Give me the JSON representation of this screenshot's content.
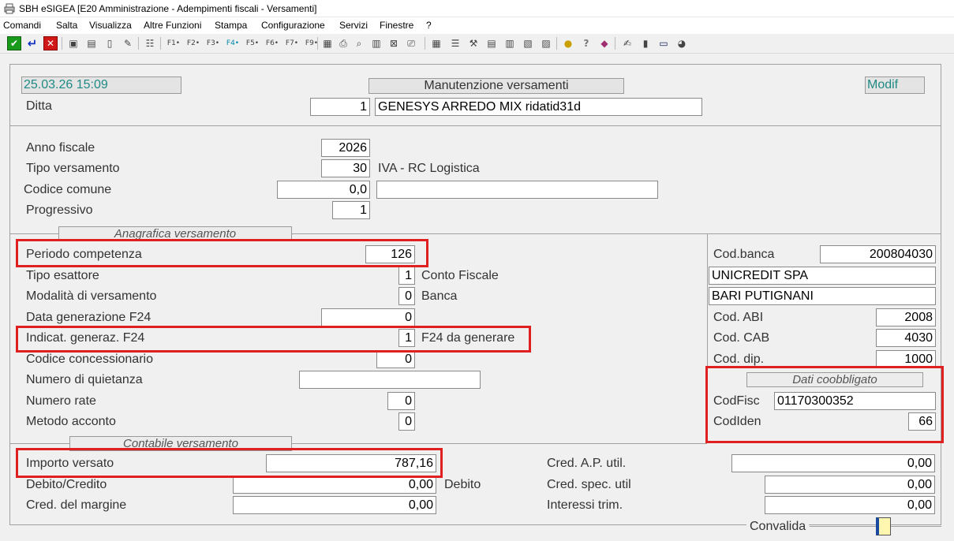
{
  "window": {
    "title": "SBH eSIGEA [E20 Amministrazione - Adempimenti fiscali - Versamenti]",
    "app_icon": "printer-icon"
  },
  "menu": [
    "Comandi",
    "Salta",
    "Visualizza",
    "Altre Funzioni",
    "Stampa",
    "Configurazione",
    "Servizi",
    "Finestre",
    "?"
  ],
  "toolbar": {
    "f_keys": [
      "F1",
      "F2",
      "F3",
      "F4",
      "F5",
      "F6",
      "F7",
      "F8",
      "F9"
    ]
  },
  "header": {
    "datetime": "25.03.26 15:09",
    "form_title": "Manutenzione versamenti",
    "mode": "Modif",
    "ditta_label": "Ditta",
    "ditta_code": "1",
    "ditta_name": "GENESYS ARREDO MIX ridatid31d"
  },
  "keys": {
    "anno_label": "Anno fiscale",
    "anno_value": "2026",
    "tipo_label": "Tipo versamento",
    "tipo_value": "30",
    "tipo_desc": "IVA - RC Logistica",
    "comune_label": "Codice comune",
    "comune_value": "0,0",
    "comune_desc": "",
    "progr_label": "Progressivo",
    "progr_value": "1"
  },
  "anagrafica": {
    "section_title": "Anagrafica versamento",
    "periodo_label": "Periodo competenza",
    "periodo_value": "126",
    "esattore_label": "Tipo esattore",
    "esattore_value": "1",
    "esattore_desc": "Conto Fiscale",
    "modalita_label": "Modalità di versamento",
    "modalita_value": "0",
    "modalita_desc": "Banca",
    "datagen_label": "Data generazione  F24",
    "datagen_value": "0",
    "indicat_label": "Indicat. generaz. F24",
    "indicat_value": "1",
    "indicat_desc": "F24 da generare",
    "conc_label": "Codice concessionario",
    "conc_value": "0",
    "quiet_label": "Numero di quietanza",
    "quiet_value": "",
    "rate_label": "Numero rate",
    "rate_value": "0",
    "metodo_label": "Metodo acconto",
    "metodo_value": "0"
  },
  "banca": {
    "codbanca_label": "Cod.banca",
    "codbanca_value": "200804030",
    "nome": "UNICREDIT SPA",
    "filiale": "BARI PUTIGNANI",
    "abi_label": "Cod. ABI",
    "abi_value": "2008",
    "cab_label": "Cod. CAB",
    "cab_value": "4030",
    "dip_label": "Cod. dip.",
    "dip_value": "1000"
  },
  "coobbligato": {
    "section_title": "Dati coobbligato",
    "codfisc_label": "CodFisc",
    "codfisc_value": "01170300352",
    "codiden_label": "CodIden",
    "codiden_value": "66"
  },
  "contabile": {
    "section_title": "Contabile versamento",
    "importo_label": "Importo versato",
    "importo_value": "787,16",
    "debcred_label": "Debito/Credito",
    "debcred_value": "0,00",
    "debcred_desc": "Debito",
    "margine_label": "Cred. del margine",
    "margine_value": "0,00",
    "credap_label": "Cred. A.P. util.",
    "credap_value": "0,00",
    "credspec_label": "Cred. spec. util",
    "credspec_value": "0,00",
    "interessi_label": "Interessi trim.",
    "interessi_value": "0,00",
    "convalida_label": "Convalida"
  },
  "colors": {
    "highlight": "#e02020",
    "teal_text": "#1f8a84"
  }
}
